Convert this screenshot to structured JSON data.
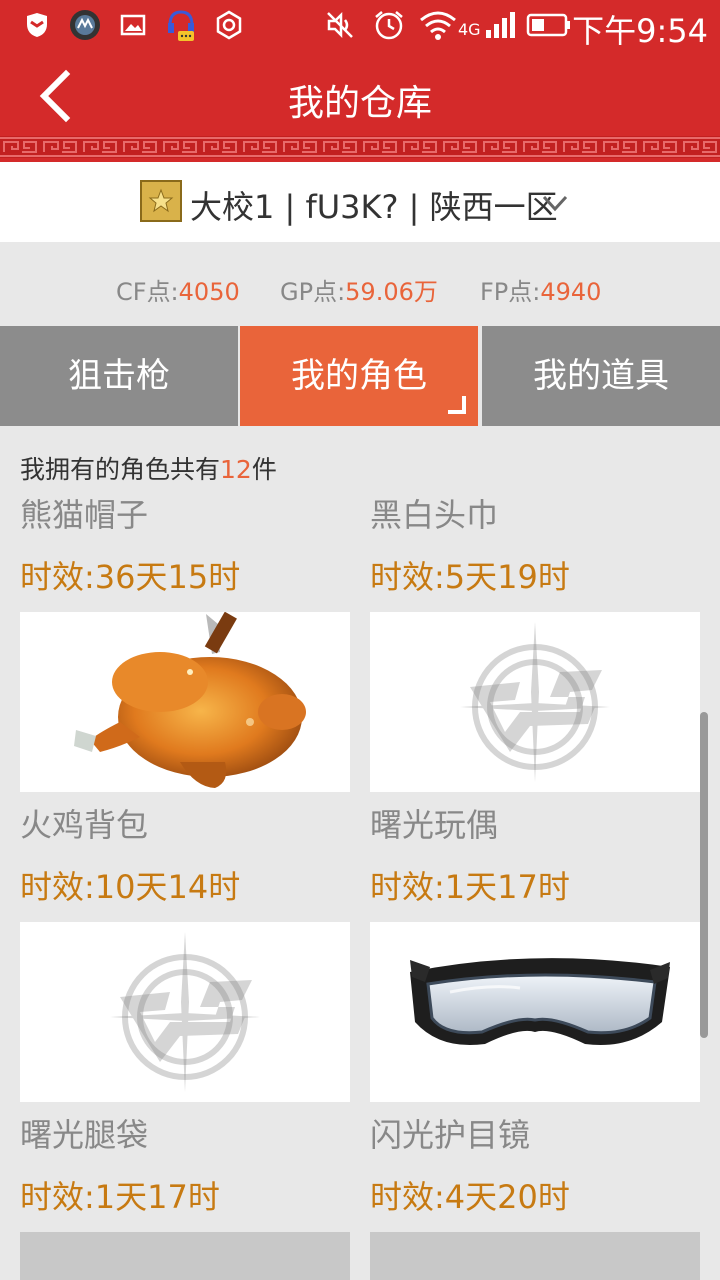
{
  "status_bar": {
    "time": "下午9:54",
    "network": "4G"
  },
  "header": {
    "title": "我的仓库",
    "back_icon": "chevron-left-icon"
  },
  "profile": {
    "text": "大校1 | fU3K? | 陕西一区",
    "dropdown_icon": "chevron-down-icon"
  },
  "points": {
    "cf_label": "CF点:",
    "cf_value": "4050",
    "gp_label": "GP点:",
    "gp_value": "59.06万",
    "fp_label": "FP点:",
    "fp_value": "4940"
  },
  "tabs": [
    {
      "label": "狙击枪",
      "active": false
    },
    {
      "label": "我的角色",
      "active": true
    },
    {
      "label": "我的道具",
      "active": false
    }
  ],
  "summary": {
    "prefix": "我拥有的角色共有",
    "count": "12",
    "suffix": "件"
  },
  "items": [
    {
      "name": "熊猫帽子",
      "time": "时效:36天15时"
    },
    {
      "name": "黑白头巾",
      "time": "时效:5天19时"
    },
    {
      "name": "火鸡背包",
      "time": "时效:10天14时",
      "image": "roast-turkey-image"
    },
    {
      "name": "曙光玩偶",
      "time": "时效:1天17时",
      "image": "cf-logo-placeholder"
    },
    {
      "name": "曙光腿袋",
      "time": "时效:1天17时",
      "image": "cf-logo-placeholder"
    },
    {
      "name": "闪光护目镜",
      "time": "时效:4天20时",
      "image": "goggles-image"
    }
  ],
  "colors": {
    "header_red": "#d42a2a",
    "accent_orange": "#e9643a",
    "time_gold": "#c77a12"
  }
}
